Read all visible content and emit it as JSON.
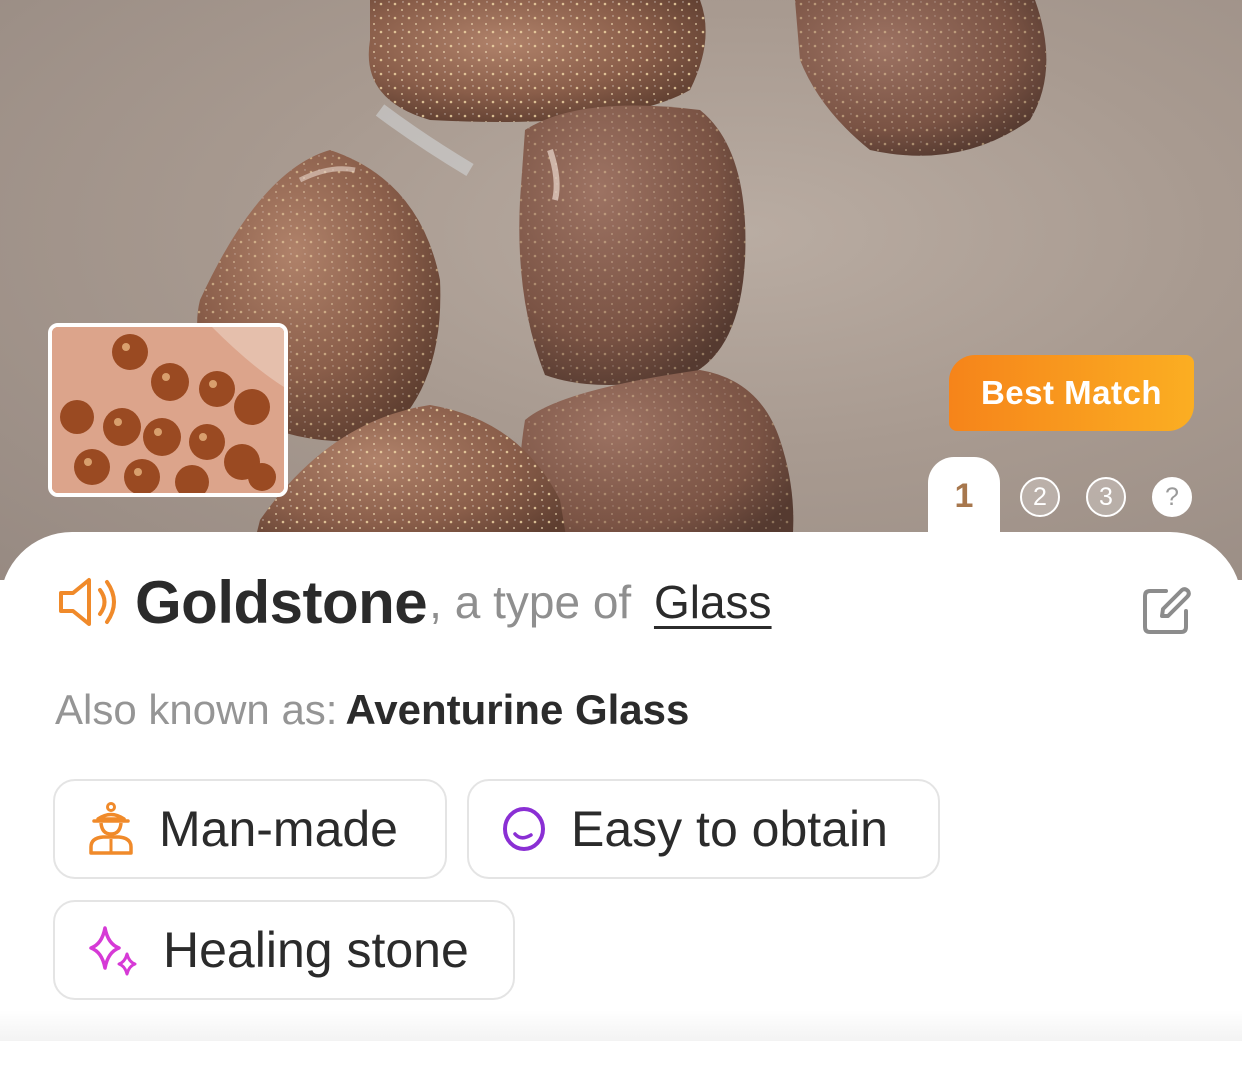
{
  "identification": {
    "name": "Goldstone",
    "type_prefix": ", a type of ",
    "type_link": "Glass",
    "also_known_label": "Also known as:",
    "also_known_value": "Aventurine Glass"
  },
  "badge": {
    "best_match_label": "Best Match"
  },
  "result_tabs": {
    "active": "1",
    "others": [
      "2",
      "3",
      "?"
    ]
  },
  "tags": [
    {
      "label": "Man-made",
      "icon": "person-icon",
      "color": "#f08a2a"
    },
    {
      "label": "Easy to obtain",
      "icon": "ring-icon",
      "color": "#8a2fd4"
    },
    {
      "label": "Healing stone",
      "icon": "sparkle-icon",
      "color": "#d63ad6"
    }
  ],
  "colors": {
    "accent_orange": "#f6841a",
    "tab_active_text": "#a7774d"
  }
}
